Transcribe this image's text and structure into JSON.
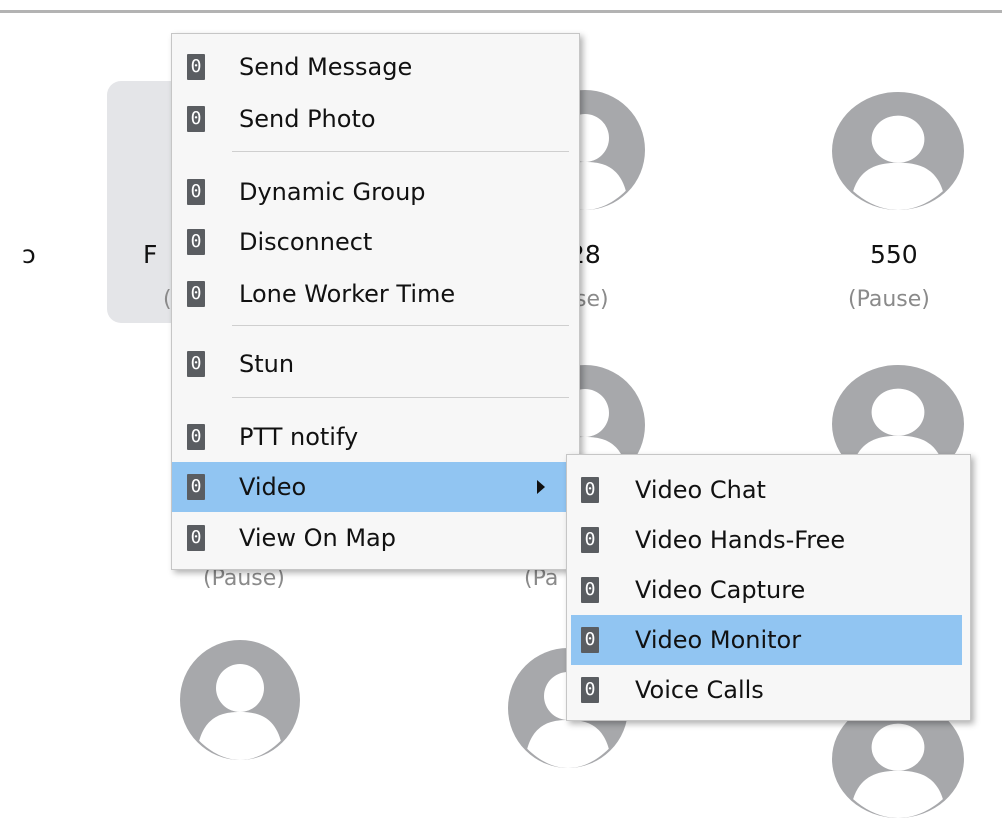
{
  "contacts": [
    {
      "name": "ɔ",
      "status": ""
    },
    {
      "name": "F",
      "status": "("
    },
    {
      "name": "28",
      "status": "se)"
    },
    {
      "name": "550",
      "status": "(Pause)"
    },
    {
      "name": "",
      "status": "(Pause)"
    },
    {
      "name": "",
      "status": "(Pa"
    }
  ],
  "context_menu": {
    "items": [
      {
        "key": "0",
        "label": "Send Message"
      },
      {
        "key": "0",
        "label": "Send Photo"
      },
      {
        "key": "0",
        "label": "Dynamic Group"
      },
      {
        "key": "0",
        "label": "Disconnect"
      },
      {
        "key": "0",
        "label": "Lone Worker Time"
      },
      {
        "key": "0",
        "label": "Stun"
      },
      {
        "key": "0",
        "label": "PTT notify"
      },
      {
        "key": "0",
        "label": "Video"
      },
      {
        "key": "0",
        "label": "View On Map"
      }
    ]
  },
  "video_submenu": {
    "items": [
      {
        "key": "0",
        "label": "Video Chat"
      },
      {
        "key": "0",
        "label": "Video Hands-Free"
      },
      {
        "key": "0",
        "label": "Video Capture"
      },
      {
        "key": "0",
        "label": "Video Monitor"
      },
      {
        "key": "0",
        "label": "Voice Calls"
      }
    ]
  },
  "colors": {
    "menu_highlight": "#91c5f2",
    "key_badge": "#5a5d61",
    "avatar": "#a7a8ab",
    "status_text": "#8a8a8a"
  }
}
